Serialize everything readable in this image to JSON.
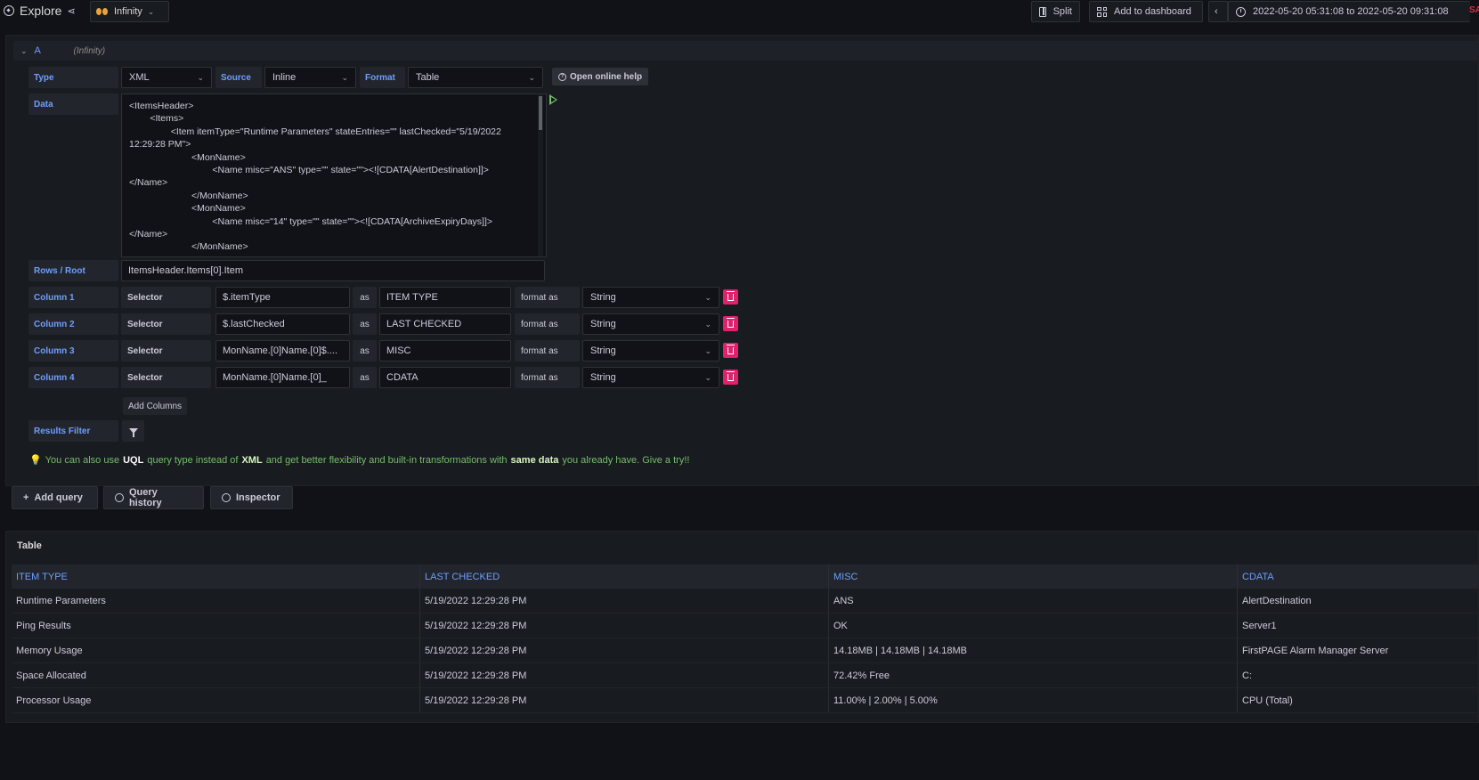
{
  "topbar": {
    "title": "Explore",
    "datasource": "Infinity",
    "split_label": "Split",
    "add_dashboard_label": "Add to dashboard",
    "time_range": "2022-05-20 05:31:08 to 2022-05-20 09:31:08",
    "user_tag": "SAS"
  },
  "query": {
    "letter": "A",
    "datasource_label": "(Infinity)",
    "type_label": "Type",
    "type_value": "XML",
    "source_label": "Source",
    "source_value": "Inline",
    "format_label": "Format",
    "format_value": "Table",
    "help_label": "Open online help",
    "data_label": "Data",
    "data_text": "<ItemsHeader>\n        <Items>\n                <Item itemType=\"Runtime Parameters\" stateEntries=\"\" lastChecked=\"5/19/2022 12:29:28 PM\">\n                        <MonName>\n                                <Name misc=\"ANS\" type=\"\" state=\"\"><![CDATA[AlertDestination]]>\n</Name>\n                        </MonName>\n                        <MonName>\n                                <Name misc=\"14\" type=\"\" state=\"\"><![CDATA[ArchiveExpiryDays]]>\n</Name>\n                        </MonName>\n                        <MonName>",
    "rows_label": "Rows / Root",
    "rows_value": "ItemsHeader.Items[0].Item",
    "selector_label": "Selector",
    "as_label": "as",
    "format_as_label": "format as",
    "columns": [
      {
        "label": "Column 1",
        "selector": "$.itemType",
        "alias": "ITEM TYPE",
        "format": "String"
      },
      {
        "label": "Column 2",
        "selector": "$.lastChecked",
        "alias": "LAST CHECKED",
        "format": "String"
      },
      {
        "label": "Column 3",
        "selector": "MonName.[0]Name.[0]$....",
        "alias": "MISC",
        "format": "String"
      },
      {
        "label": "Column 4",
        "selector": "MonName.[0]Name.[0]_",
        "alias": "CDATA",
        "format": "String"
      }
    ],
    "add_columns_label": "Add Columns",
    "results_filter_label": "Results Filter",
    "hint": {
      "p1": "You can also use",
      "uql": "UQL",
      "p2": "query type instead of",
      "xml": "XML",
      "p3": "and get better flexibility and built-in transformations with",
      "same": "same data",
      "p4": "you already have. Give a try!!"
    }
  },
  "actions": {
    "add_query": "Add query",
    "query_history": "Query history",
    "inspector": "Inspector"
  },
  "table": {
    "title": "Table",
    "headers": [
      "ITEM TYPE",
      "LAST CHECKED",
      "MISC",
      "CDATA"
    ],
    "rows": [
      [
        "Runtime Parameters",
        "5/19/2022 12:29:28 PM",
        "ANS",
        "AlertDestination"
      ],
      [
        "Ping Results",
        "5/19/2022 12:29:28 PM",
        "OK",
        "Server1"
      ],
      [
        "Memory Usage",
        "5/19/2022 12:29:28 PM",
        "14.18MB | 14.18MB | 14.18MB",
        "FirstPAGE Alarm Manager Server"
      ],
      [
        "Space Allocated",
        "5/19/2022 12:29:28 PM",
        "72.42% Free",
        "C:"
      ],
      [
        "Processor Usage",
        "5/19/2022 12:29:28 PM",
        "11.00% | 2.00% | 5.00%",
        "CPU (Total)"
      ]
    ]
  },
  "colors": {
    "accent_blue": "#6e9fff",
    "hint_green": "#73bf69",
    "delete_pink": "#e0226e",
    "background": "#111217"
  }
}
